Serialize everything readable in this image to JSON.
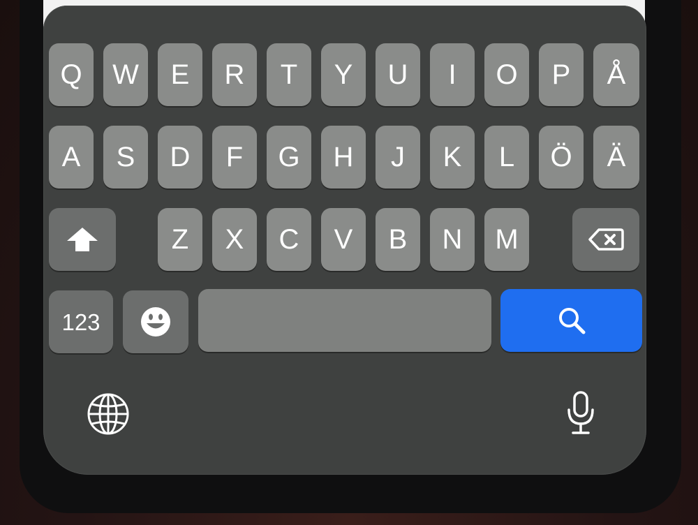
{
  "keyboard": {
    "row1": [
      "Q",
      "W",
      "E",
      "R",
      "T",
      "Y",
      "U",
      "I",
      "O",
      "P",
      "Å"
    ],
    "row2": [
      "A",
      "S",
      "D",
      "F",
      "G",
      "H",
      "J",
      "K",
      "L",
      "Ö",
      "Ä"
    ],
    "row3": [
      "Z",
      "X",
      "C",
      "V",
      "B",
      "N",
      "M"
    ],
    "numbers_label": "123",
    "icons": {
      "shift": "shift-arrow-icon",
      "backspace": "backspace-icon",
      "emoji": "emoji-face-icon",
      "search": "search-icon",
      "globe": "globe-icon",
      "microphone": "microphone-icon"
    },
    "colors": {
      "keyboard_bg": "#3f4140",
      "key_bg": "#8a8c8a",
      "function_key_bg": "#6c6e6d",
      "search_key_bg": "#1f6ef0",
      "key_text": "#ffffff"
    }
  }
}
